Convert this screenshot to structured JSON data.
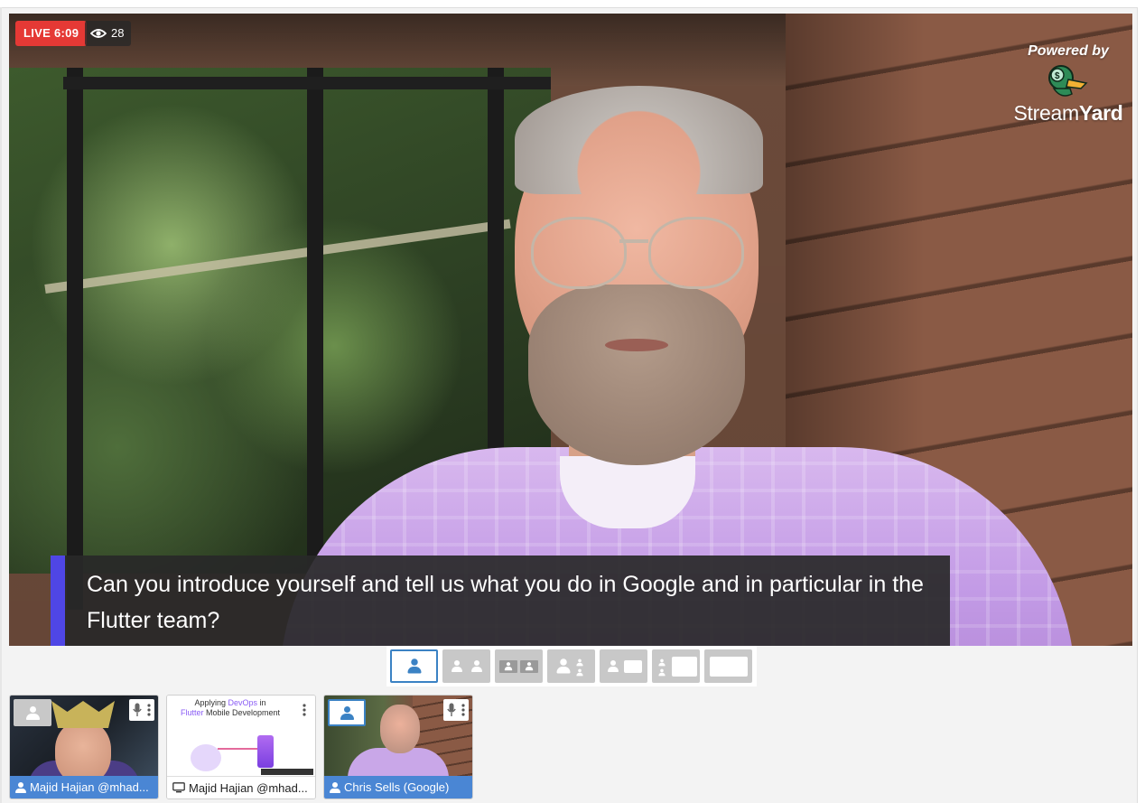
{
  "stage": {
    "live_label": "LIVE 6:09",
    "viewer_count": "28",
    "powered_by": "Powered by",
    "brand_first": "Stream",
    "brand_second": "Yard",
    "caption": "Can you introduce yourself and tell us what you do in Google and in particular in the Flutter team?"
  },
  "layouts": [
    {
      "name": "solo",
      "active": true
    },
    {
      "name": "group-two"
    },
    {
      "name": "group-small"
    },
    {
      "name": "leader"
    },
    {
      "name": "side-by-side"
    },
    {
      "name": "thin-left"
    },
    {
      "name": "fullscreen"
    }
  ],
  "participants": [
    {
      "name": "Majid Hajian @mhad...",
      "type": "camera",
      "on_stage": false
    },
    {
      "name": "Majid Hajian @mhad...",
      "type": "screen",
      "on_stage": false,
      "slide_line1_pre": "Applying ",
      "slide_line1_hl": "DevOps",
      "slide_line1_post": " in",
      "slide_line2_hl": "Flutter",
      "slide_line2_post": " Mobile Development"
    },
    {
      "name": "Chris Sells (Google)",
      "type": "camera",
      "on_stage": true
    }
  ],
  "colors": {
    "live": "#e53935",
    "caption_accent": "#4f46e5",
    "namebar": "#4a86d4",
    "active_outline": "#3b82c4"
  }
}
